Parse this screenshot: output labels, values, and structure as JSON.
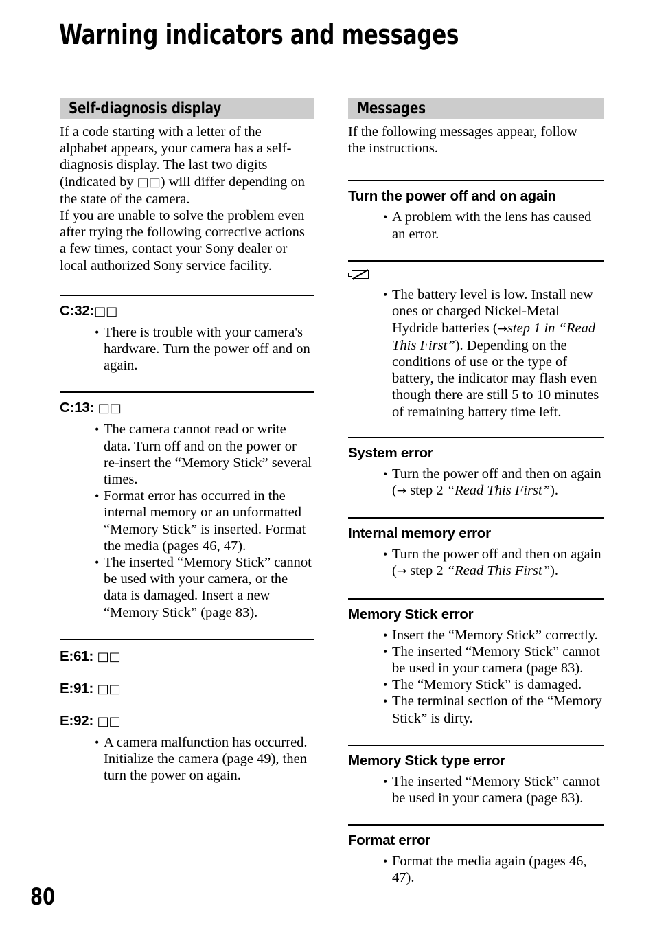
{
  "document": {
    "title": "Warning indicators and messages",
    "page_number": "80"
  },
  "left_column": {
    "section_title": "Self-diagnosis display",
    "intro_line_1": "If a code starting with a letter of the",
    "intro_line_2": "alphabet appears, your camera has a self-",
    "intro_line_3": "diagnosis display. The last two digits",
    "intro_line_4a": "(indicated by ",
    "intro_line_4b": "□□",
    "intro_line_4c": ") will differ depending on",
    "intro_line_5": "the state of the camera.",
    "intro_line_6": "If you are unable to solve the problem even",
    "intro_line_7": "after trying the following corrective actions",
    "intro_line_8": "a few times, contact your Sony dealer or",
    "intro_line_9": "local authorized Sony service facility.",
    "entries": [
      {
        "code": "C:32:",
        "boxes": "□□",
        "bullets": [
          "There is trouble with your camera's hardware. Turn the power off and on again."
        ]
      },
      {
        "code": "C:13: ",
        "boxes": "□□",
        "bullets": [
          "The camera cannot read or write data. Turn off and on the power or re-insert the “Memory Stick” several times.",
          "Format error has occurred in the internal memory or an unformatted “Memory Stick” is inserted. Format the media (pages 46, 47).",
          "The inserted “Memory Stick” cannot be used with your camera, or the data is damaged. Insert a new “Memory Stick” (page 83)."
        ]
      },
      {
        "code": "E:61: ",
        "boxes": "□□",
        "bullets": []
      },
      {
        "code": "E:91: ",
        "boxes": "□□",
        "bullets": []
      },
      {
        "code": "E:92: ",
        "boxes": "□□",
        "bullets": [
          "A camera malfunction has occurred. Initialize the camera (page 49), then turn the power on again."
        ]
      }
    ]
  },
  "right_column": {
    "section_title": "Messages",
    "intro_line_1": "If the following messages appear, follow",
    "intro_line_2": "the instructions.",
    "entries": {
      "power_off_on": {
        "heading": "Turn the power off and on again",
        "bullet": "A problem with the lens has caused an error."
      },
      "battery_low": {
        "icon": "low-battery-icon",
        "bullet_part_1": "The battery level is low. Install new ones or charged Nickel-Metal Hydride batteries (",
        "arrow": "→",
        "bullet_italic_1": "step 1 in “Read This First”",
        "bullet_part_2": "). Depending on the conditions of use or the type of battery, the indicator may flash even though there are still 5 to 10 minutes of remaining battery time left."
      },
      "system_error": {
        "heading": "System error",
        "bullet_part_1": "Turn the power off and then on again (",
        "arrow": "→",
        "bullet_step": " step 2 ",
        "bullet_italic": "“Read This First”",
        "bullet_part_2": ")."
      },
      "internal_memory_error": {
        "heading": "Internal memory error",
        "bullet_part_1": "Turn the power off and then on again (",
        "arrow": "→",
        "bullet_step": " step 2 ",
        "bullet_italic": "“Read This First”",
        "bullet_part_2": ")."
      },
      "memory_stick_error": {
        "heading": "Memory Stick error",
        "bullets": [
          "Insert the “Memory Stick” correctly.",
          "The inserted “Memory Stick” cannot be used in your camera (page 83).",
          "The “Memory Stick” is damaged.",
          "The terminal section of the “Memory Stick” is dirty."
        ]
      },
      "memory_stick_type_error": {
        "heading": "Memory Stick type error",
        "bullets": [
          "The inserted “Memory Stick” cannot be used in your camera (page 83)."
        ]
      },
      "format_error": {
        "heading": "Format error",
        "bullets": [
          "Format the media again (pages 46, 47)."
        ]
      }
    }
  },
  "colors": {
    "section_bar_background": "#cccccc",
    "text": "#000000",
    "rule": "#000000",
    "page_background": "#ffffff"
  }
}
